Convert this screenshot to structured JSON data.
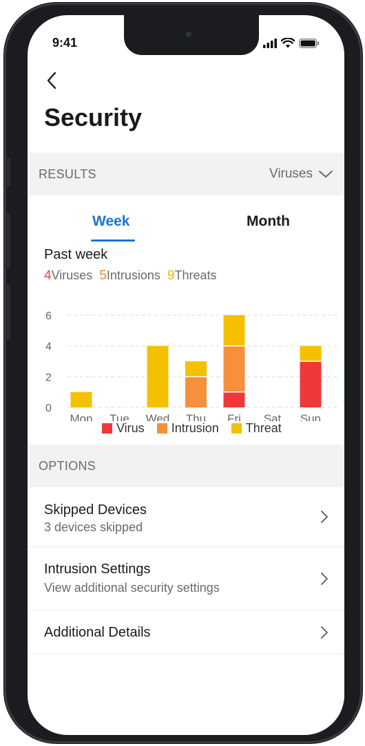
{
  "status": {
    "time": "9:41"
  },
  "page": {
    "title": "Security"
  },
  "results": {
    "label": "RESULTS",
    "filter_value": "Viruses",
    "tabs": [
      {
        "label": "Week",
        "active": true
      },
      {
        "label": "Month",
        "active": false
      }
    ],
    "period": "Past week",
    "summary": [
      {
        "count": "4",
        "label": "Viruses",
        "color": "#f0443a"
      },
      {
        "count": "5",
        "label": "Intrusions",
        "color": "#f08a2a"
      },
      {
        "count": "9",
        "label": "Threats",
        "color": "#f2b800"
      }
    ]
  },
  "chart_data": {
    "type": "bar",
    "stacked": true,
    "categories": [
      "Mon",
      "Tue",
      "Wed",
      "Thu",
      "Fri",
      "Sat",
      "Sun"
    ],
    "series": [
      {
        "name": "Virus",
        "color": "#f0383a",
        "values": [
          0,
          0,
          0,
          0,
          1,
          0,
          3
        ]
      },
      {
        "name": "Intrusion",
        "color": "#f6903d",
        "values": [
          0,
          0,
          0,
          2,
          3,
          0,
          0
        ]
      },
      {
        "name": "Threat",
        "color": "#f5c000",
        "values": [
          1,
          0,
          4,
          1,
          2,
          0,
          1
        ]
      }
    ],
    "y_ticks": [
      "0",
      "2",
      "4",
      "6"
    ],
    "ylim": [
      0,
      6
    ],
    "grid": true,
    "legend_position": "bottom"
  },
  "options": {
    "label": "OPTIONS",
    "items": [
      {
        "title": "Skipped Devices",
        "subtitle": "3 devices skipped"
      },
      {
        "title": "Intrusion Settings",
        "subtitle": "View additional security settings"
      },
      {
        "title": "Additional Details"
      }
    ]
  },
  "icons": [
    "back-icon",
    "chevron-down-icon",
    "chevron-right-icon",
    "signal-icon",
    "wifi-icon",
    "battery-icon"
  ]
}
